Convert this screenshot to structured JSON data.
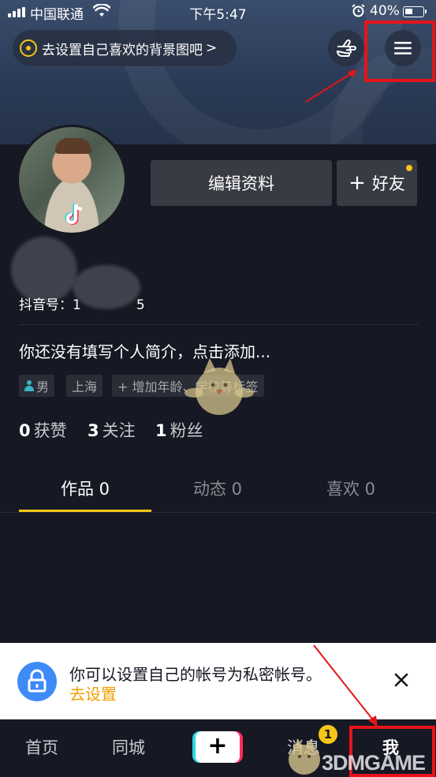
{
  "status_bar": {
    "carrier": "中国联通",
    "time": "下午5:47",
    "battery": "40%"
  },
  "header": {
    "background_hint": "去设置自己喜欢的背景图吧",
    "background_hint_chevron": ">",
    "icons": [
      "target-dot-icon",
      "pointing-hand-icon",
      "hamburger-menu-icon"
    ]
  },
  "profile": {
    "edit_button": "编辑资料",
    "add_friend_button": "好友",
    "add_friend_plus": "+",
    "douyin_id_label": "抖音号：1",
    "douyin_id_suffix": "5",
    "bio_placeholder": "你还没有填写个人简介，点击添加...",
    "tags": {
      "gender": "男",
      "location": "上海",
      "add_more": "+ 增加年龄、学校等标签"
    },
    "stats": [
      {
        "value": "0",
        "label": "获赞"
      },
      {
        "value": "3",
        "label": "关注"
      },
      {
        "value": "1",
        "label": "粉丝"
      }
    ]
  },
  "tabs": [
    {
      "label": "作品 0",
      "active": true
    },
    {
      "label": "动态 0",
      "active": false
    },
    {
      "label": "喜欢 0",
      "active": false
    }
  ],
  "privacy_banner": {
    "message": "你可以设置自己的帐号为私密帐号。",
    "action": "去设置"
  },
  "bottom_nav": {
    "items": [
      "首页",
      "同城",
      "消息",
      "我"
    ],
    "plus_label": "+",
    "message_badge": "1",
    "active": "我"
  },
  "watermark": "3DMGAME",
  "colors": {
    "background": "#161823",
    "accent": "#f5c518",
    "highlight_box": "#e5141a",
    "link": "#f0a000"
  }
}
